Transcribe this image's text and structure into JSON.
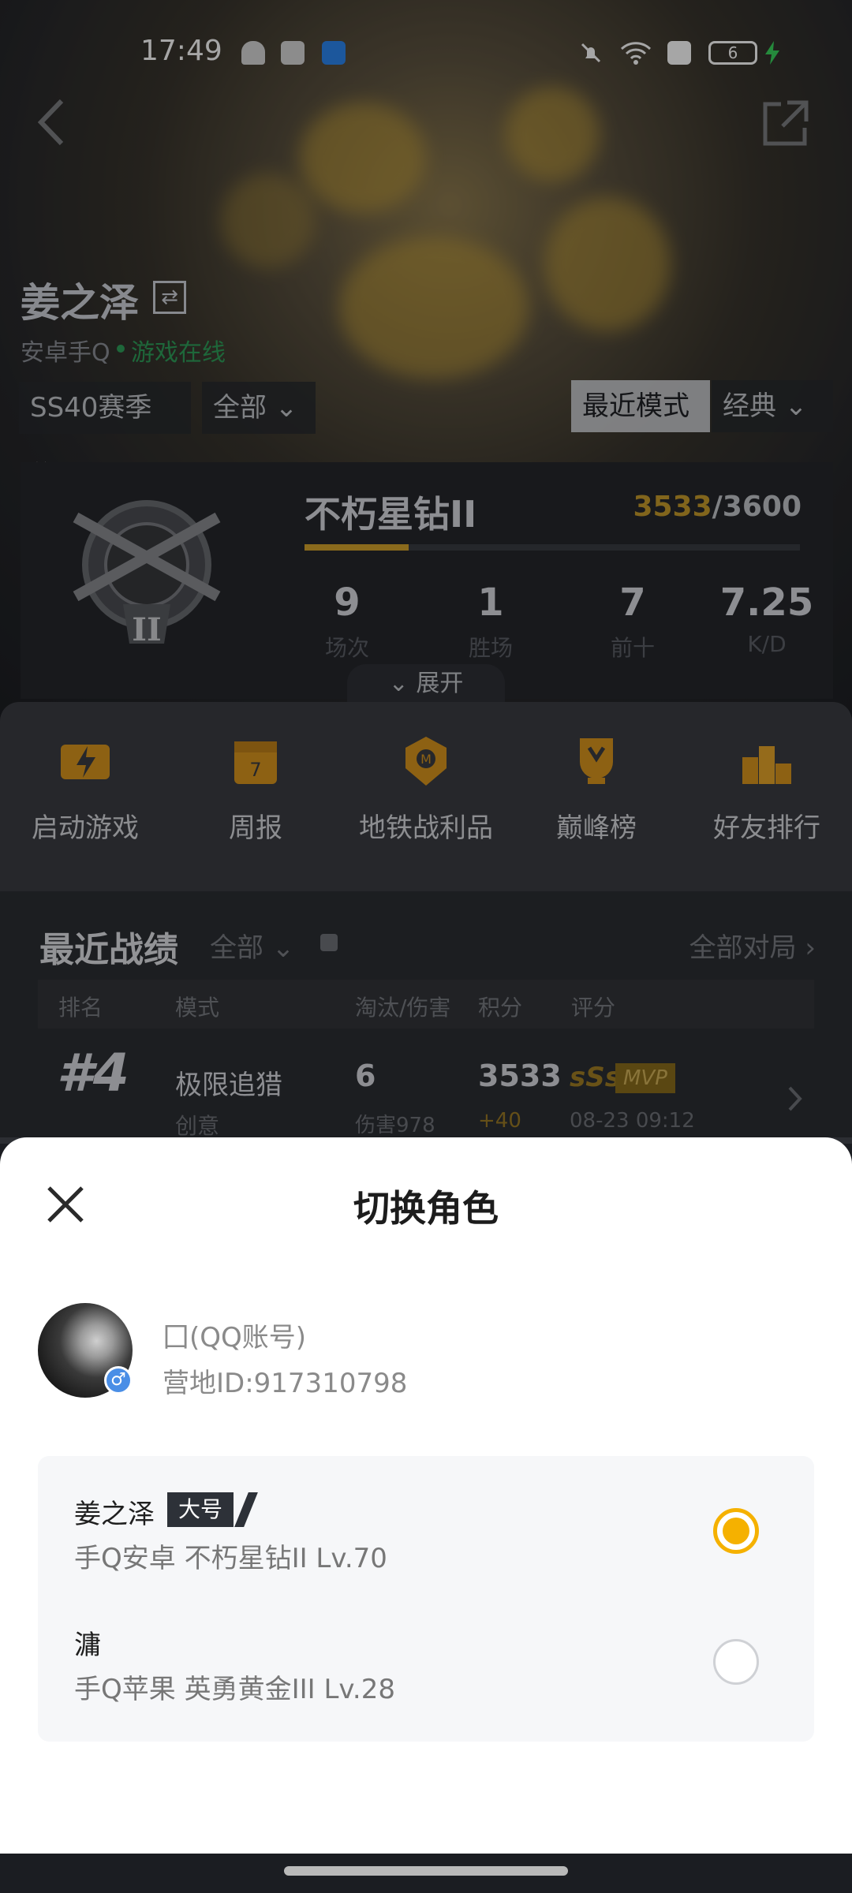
{
  "status_bar": {
    "time": "17:49",
    "battery": "6"
  },
  "player": {
    "name": "姜之泽",
    "platform": "安卓手Q",
    "status": "游戏在线"
  },
  "filters": {
    "season": "SS40赛季 ⌄",
    "scope": "全部 ⌄",
    "mode_recent": "最近模式",
    "mode_classic": "经典 ⌄"
  },
  "rank": {
    "tier_name": "不朽星钻II",
    "points_current": "3533",
    "points_total": "/3600",
    "progress": 0.21,
    "stats": [
      {
        "value": "9",
        "label": "场次"
      },
      {
        "value": "1",
        "label": "胜场"
      },
      {
        "value": "7",
        "label": "前十"
      },
      {
        "value": "7.25",
        "label": "K/D"
      }
    ],
    "expand_label": "⌄ 展开"
  },
  "quick_actions": [
    {
      "label": "启动游戏",
      "icon": "lightning-icon"
    },
    {
      "label": "周报",
      "icon": "calendar-icon"
    },
    {
      "label": "地铁战利品",
      "icon": "metro-badge-icon"
    },
    {
      "label": "巅峰榜",
      "icon": "peak-trophy-icon"
    },
    {
      "label": "好友排行",
      "icon": "podium-icon"
    }
  ],
  "matches": {
    "title": "最近战绩",
    "filter": "全部 ⌄",
    "view_all": "全部对局 ›",
    "headers": {
      "rank": "排名",
      "mode": "模式",
      "kills": "淘汰/伤害",
      "score": "积分",
      "rating": "评分"
    },
    "rows": [
      {
        "rank": "#4",
        "mode": "极限追猎",
        "sub": "创意",
        "kills": "6",
        "damage": "伤害978",
        "score": "3533",
        "delta": "+40",
        "grade": "sSs",
        "mvp": "MVP",
        "date": "08-23 09:12"
      }
    ]
  },
  "sheet": {
    "title": "切换角色",
    "account": "囗(QQ账号)",
    "camp_id": "营地ID:917310798",
    "roles": [
      {
        "name": "姜之泽",
        "tag": "大号",
        "detail": "手Q安卓  不朽星钻II  Lv.70",
        "selected": true
      },
      {
        "name": "滽",
        "tag": "",
        "detail": "手Q苹果  英勇黄金III  Lv.28",
        "selected": false
      }
    ]
  },
  "colors": {
    "accent": "#f5b100",
    "online": "#2e9e5a",
    "gold": "#c79b2b"
  }
}
